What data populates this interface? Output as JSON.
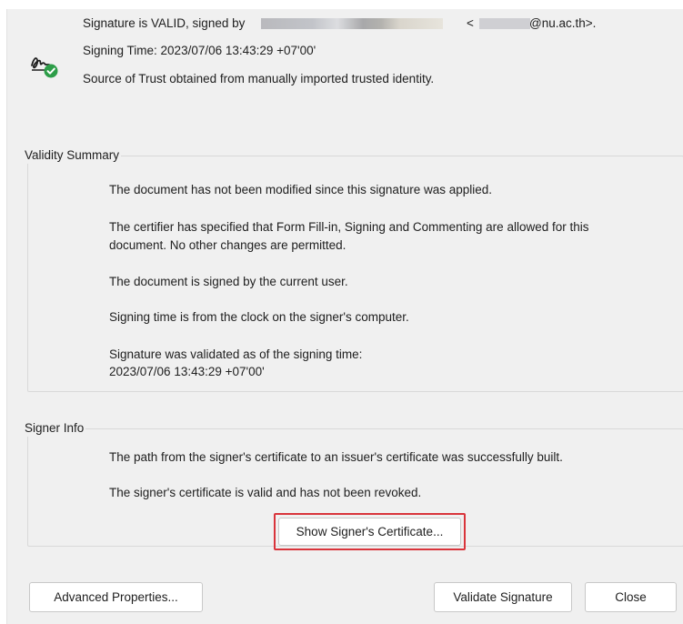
{
  "header": {
    "line1_prefix": "Signature is VALID, signed by",
    "email_open": "<",
    "email_suffix": "@nu.ac.th>.",
    "signing_time": "Signing Time:  2023/07/06 13:43:29 +07'00'",
    "trust_source": "Source of Trust obtained from manually imported trusted identity.",
    "icon": "signature-valid-check-icon"
  },
  "validity_summary": {
    "title": "Validity Summary",
    "not_modified": "The document has not been modified since this signature was applied.",
    "certifier_line1": "The certifier has specified that Form Fill-in, Signing and Commenting are allowed for this",
    "certifier_line2": "document. No other changes are permitted.",
    "signed_by_current_user": "The document is signed by the current user.",
    "signing_time_source": "Signing time is from the clock on the signer's computer.",
    "validated_as_of": "Signature was validated as of the signing time:",
    "validated_time": "2023/07/06 13:43:29 +07'00'"
  },
  "signer_info": {
    "title": "Signer Info",
    "path_built": "The path from the signer's certificate to an issuer's certificate was successfully built.",
    "cert_valid": "The signer's certificate is valid and has not been revoked.",
    "show_cert_button": "Show Signer's Certificate..."
  },
  "footer": {
    "advanced_properties": "Advanced Properties...",
    "validate_signature": "Validate Signature",
    "close": "Close"
  },
  "colors": {
    "dialog_bg": "#f0f0f0",
    "highlight_border": "#d9343b",
    "valid_badge": "#2d9d48"
  }
}
